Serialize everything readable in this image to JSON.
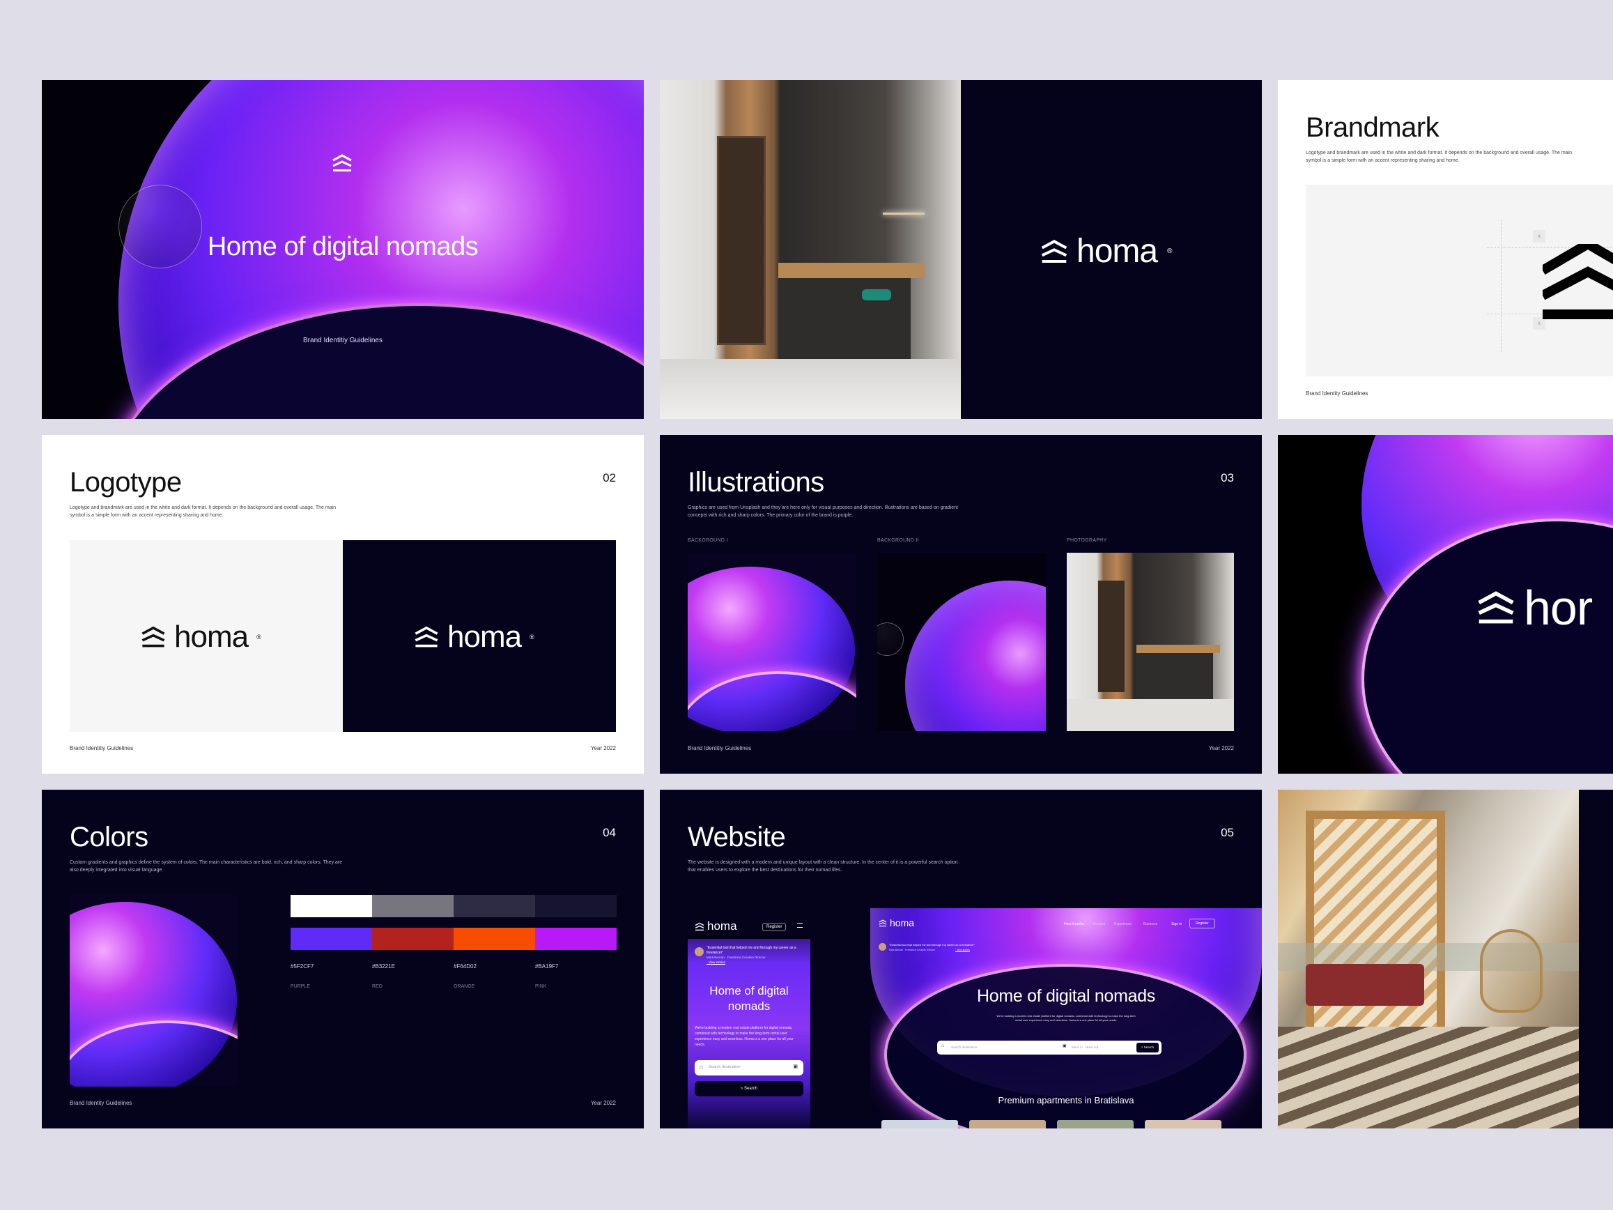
{
  "slide1": {
    "title": "Home of digital nomads",
    "subtitle": "Brand Identitiy Guidelines"
  },
  "slide2": {
    "logo": "homa"
  },
  "slide3": {
    "title": "Brandmark",
    "desc": "Logotype and brandmark are used in the white and dark format. It depends on the background and overall usage. The main symbol is a simple form with an accent representing sharing and home.",
    "footer": "Brand Identity Guidelines",
    "x_marks": [
      "x",
      "x"
    ]
  },
  "logotype": {
    "title": "Logotype",
    "num": "02",
    "desc": "Logotype and brandmark are used in the white and dark format. It depends on the background and overall usage. The main symbol is a simple form with an accent representing sharing and home.",
    "logo": "homa",
    "footer_left": "Brand Identitiy Guidelines",
    "footer_right": "Year 2022"
  },
  "illustrations": {
    "title": "Illustrations",
    "num": "03",
    "desc": "Graphics are used from Unsplash and they are here only for visual purposes and direction. Illustrations are based on gradient concepts with rich and sharp colors. The primary color of the brand is purple.",
    "labels": [
      "BACKGROUND I",
      "BACKGROUND II",
      "PHOTOGRAPHY"
    ],
    "footer_left": "Brand Identitiy Guidelines",
    "footer_right": "Year 2022"
  },
  "slide6": {
    "logo": "hor"
  },
  "colors": {
    "title": "Colors",
    "num": "04",
    "desc": "Custom gradients and graphics define the system of colors. The main characteristics are bold, rich, and sharp colors. They are also deeply integrated into visual language.",
    "neutrals": [
      "#ffffff",
      "#77767f",
      "#2e2c45",
      "#16142e"
    ],
    "accents": [
      {
        "hex": "#5F2CF7",
        "name": "PURPLE"
      },
      {
        "hex": "#B3221E",
        "name": "RED"
      },
      {
        "hex": "#F64D02",
        "name": "ORANGE"
      },
      {
        "hex": "#BA19F7",
        "name": "PINK"
      }
    ],
    "footer_left": "Brand Identity Guidelines",
    "footer_right": "Year 2022"
  },
  "website": {
    "title": "Website",
    "num": "05",
    "desc": "The website is designed with a modern and unique layout with a clean structure. In the center of it is a powerful search option that enables users to explore the best destinations for their nomad lifes.",
    "mobile": {
      "logo": "homa",
      "register": "Register",
      "quote": "\"Essential tool that helped me and through my career as a freelancer\"",
      "quote_author": "Mark Bernan · Freelance Creative Director",
      "quote_link": "· View stories",
      "headline": "Home of digital nomads",
      "body": "We're building a modern real estate platform for digital nomads, combined with technology to make the long-term rental user experience easy and seamless. Homa is a one place for all your needs.",
      "search_placeholder": "Search destination",
      "search_button": "Search"
    },
    "desktop": {
      "logo": "homa",
      "nav": [
        "How it works",
        "Product",
        "Experience",
        "Business"
      ],
      "signin": "Sign in",
      "register": "Register",
      "quote": "\"Essential tool that helped me and through my career as a freelancer\"",
      "quote_author": "Mark Bernan · Freelance Creative Director",
      "quote_link": "· View stories",
      "headline": "Home of digital nomads",
      "body": "We're building a modern real estate platform for digital nomads, combined with technology to make the long-term rental user experience easy and seamless. Homa is a one place for all your needs.",
      "search_placeholder": "Search destination",
      "dates": "Move in · Move out",
      "search_button": "Search",
      "section": "Premium apartments in Bratislava"
    }
  }
}
